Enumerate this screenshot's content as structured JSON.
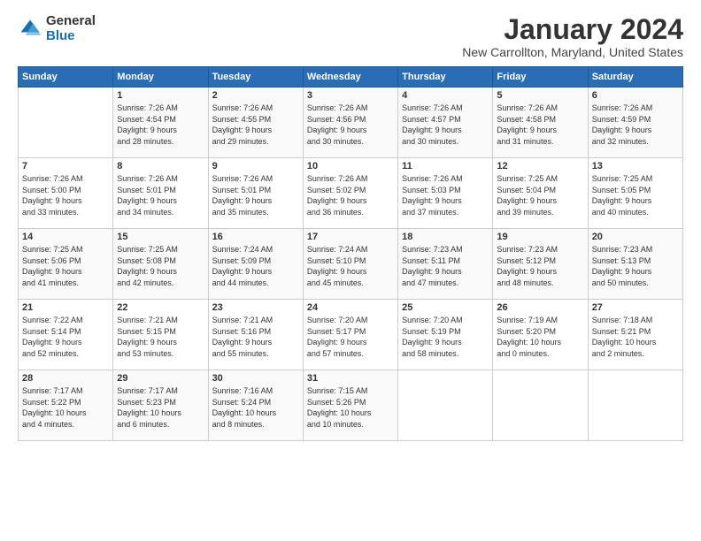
{
  "header": {
    "logo_general": "General",
    "logo_blue": "Blue",
    "month_title": "January 2024",
    "subtitle": "New Carrollton, Maryland, United States"
  },
  "weekdays": [
    "Sunday",
    "Monday",
    "Tuesday",
    "Wednesday",
    "Thursday",
    "Friday",
    "Saturday"
  ],
  "weeks": [
    [
      {
        "day": "",
        "info": ""
      },
      {
        "day": "1",
        "info": "Sunrise: 7:26 AM\nSunset: 4:54 PM\nDaylight: 9 hours\nand 28 minutes."
      },
      {
        "day": "2",
        "info": "Sunrise: 7:26 AM\nSunset: 4:55 PM\nDaylight: 9 hours\nand 29 minutes."
      },
      {
        "day": "3",
        "info": "Sunrise: 7:26 AM\nSunset: 4:56 PM\nDaylight: 9 hours\nand 30 minutes."
      },
      {
        "day": "4",
        "info": "Sunrise: 7:26 AM\nSunset: 4:57 PM\nDaylight: 9 hours\nand 30 minutes."
      },
      {
        "day": "5",
        "info": "Sunrise: 7:26 AM\nSunset: 4:58 PM\nDaylight: 9 hours\nand 31 minutes."
      },
      {
        "day": "6",
        "info": "Sunrise: 7:26 AM\nSunset: 4:59 PM\nDaylight: 9 hours\nand 32 minutes."
      }
    ],
    [
      {
        "day": "7",
        "info": "Sunrise: 7:26 AM\nSunset: 5:00 PM\nDaylight: 9 hours\nand 33 minutes."
      },
      {
        "day": "8",
        "info": "Sunrise: 7:26 AM\nSunset: 5:01 PM\nDaylight: 9 hours\nand 34 minutes."
      },
      {
        "day": "9",
        "info": "Sunrise: 7:26 AM\nSunset: 5:01 PM\nDaylight: 9 hours\nand 35 minutes."
      },
      {
        "day": "10",
        "info": "Sunrise: 7:26 AM\nSunset: 5:02 PM\nDaylight: 9 hours\nand 36 minutes."
      },
      {
        "day": "11",
        "info": "Sunrise: 7:26 AM\nSunset: 5:03 PM\nDaylight: 9 hours\nand 37 minutes."
      },
      {
        "day": "12",
        "info": "Sunrise: 7:25 AM\nSunset: 5:04 PM\nDaylight: 9 hours\nand 39 minutes."
      },
      {
        "day": "13",
        "info": "Sunrise: 7:25 AM\nSunset: 5:05 PM\nDaylight: 9 hours\nand 40 minutes."
      }
    ],
    [
      {
        "day": "14",
        "info": "Sunrise: 7:25 AM\nSunset: 5:06 PM\nDaylight: 9 hours\nand 41 minutes."
      },
      {
        "day": "15",
        "info": "Sunrise: 7:25 AM\nSunset: 5:08 PM\nDaylight: 9 hours\nand 42 minutes."
      },
      {
        "day": "16",
        "info": "Sunrise: 7:24 AM\nSunset: 5:09 PM\nDaylight: 9 hours\nand 44 minutes."
      },
      {
        "day": "17",
        "info": "Sunrise: 7:24 AM\nSunset: 5:10 PM\nDaylight: 9 hours\nand 45 minutes."
      },
      {
        "day": "18",
        "info": "Sunrise: 7:23 AM\nSunset: 5:11 PM\nDaylight: 9 hours\nand 47 minutes."
      },
      {
        "day": "19",
        "info": "Sunrise: 7:23 AM\nSunset: 5:12 PM\nDaylight: 9 hours\nand 48 minutes."
      },
      {
        "day": "20",
        "info": "Sunrise: 7:23 AM\nSunset: 5:13 PM\nDaylight: 9 hours\nand 50 minutes."
      }
    ],
    [
      {
        "day": "21",
        "info": "Sunrise: 7:22 AM\nSunset: 5:14 PM\nDaylight: 9 hours\nand 52 minutes."
      },
      {
        "day": "22",
        "info": "Sunrise: 7:21 AM\nSunset: 5:15 PM\nDaylight: 9 hours\nand 53 minutes."
      },
      {
        "day": "23",
        "info": "Sunrise: 7:21 AM\nSunset: 5:16 PM\nDaylight: 9 hours\nand 55 minutes."
      },
      {
        "day": "24",
        "info": "Sunrise: 7:20 AM\nSunset: 5:17 PM\nDaylight: 9 hours\nand 57 minutes."
      },
      {
        "day": "25",
        "info": "Sunrise: 7:20 AM\nSunset: 5:19 PM\nDaylight: 9 hours\nand 58 minutes."
      },
      {
        "day": "26",
        "info": "Sunrise: 7:19 AM\nSunset: 5:20 PM\nDaylight: 10 hours\nand 0 minutes."
      },
      {
        "day": "27",
        "info": "Sunrise: 7:18 AM\nSunset: 5:21 PM\nDaylight: 10 hours\nand 2 minutes."
      }
    ],
    [
      {
        "day": "28",
        "info": "Sunrise: 7:17 AM\nSunset: 5:22 PM\nDaylight: 10 hours\nand 4 minutes."
      },
      {
        "day": "29",
        "info": "Sunrise: 7:17 AM\nSunset: 5:23 PM\nDaylight: 10 hours\nand 6 minutes."
      },
      {
        "day": "30",
        "info": "Sunrise: 7:16 AM\nSunset: 5:24 PM\nDaylight: 10 hours\nand 8 minutes."
      },
      {
        "day": "31",
        "info": "Sunrise: 7:15 AM\nSunset: 5:26 PM\nDaylight: 10 hours\nand 10 minutes."
      },
      {
        "day": "",
        "info": ""
      },
      {
        "day": "",
        "info": ""
      },
      {
        "day": "",
        "info": ""
      }
    ]
  ]
}
